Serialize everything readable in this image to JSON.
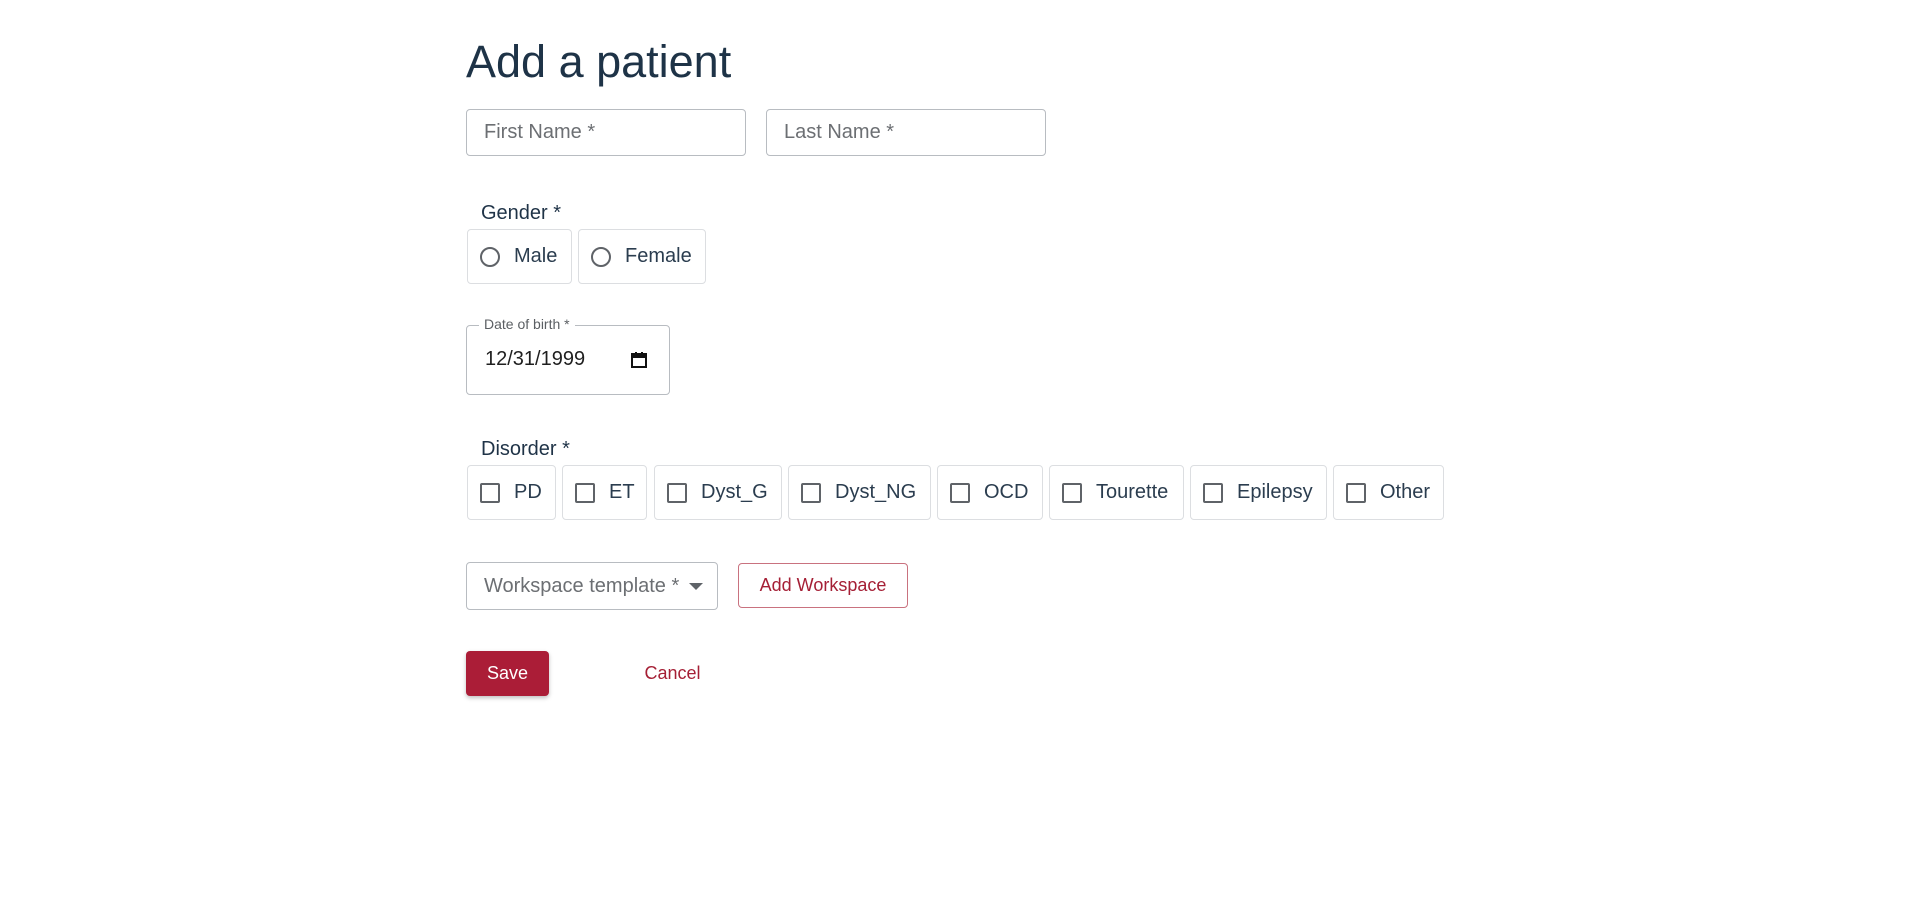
{
  "page": {
    "title": "Add a patient"
  },
  "fields": {
    "first_name": {
      "placeholder": "First Name *"
    },
    "last_name": {
      "placeholder": "Last Name *"
    },
    "date_of_birth": {
      "label": "Date of birth *",
      "value": "12/31/1999"
    },
    "workspace_template": {
      "placeholder": "Workspace template *"
    }
  },
  "gender": {
    "label": "Gender *",
    "options": [
      "Male",
      "Female"
    ]
  },
  "disorder": {
    "label": "Disorder *",
    "options": [
      "PD",
      "ET",
      "Dyst_G",
      "Dyst_NG",
      "OCD",
      "Tourette",
      "Epilepsy",
      "Other"
    ]
  },
  "buttons": {
    "add_workspace": "Add Workspace",
    "save": "Save",
    "cancel": "Cancel"
  },
  "colors": {
    "accent": "#ab1d37",
    "heading": "#1e3347"
  },
  "icons": {
    "date_picker": "calendar-icon",
    "select": "caret-down-icon"
  }
}
